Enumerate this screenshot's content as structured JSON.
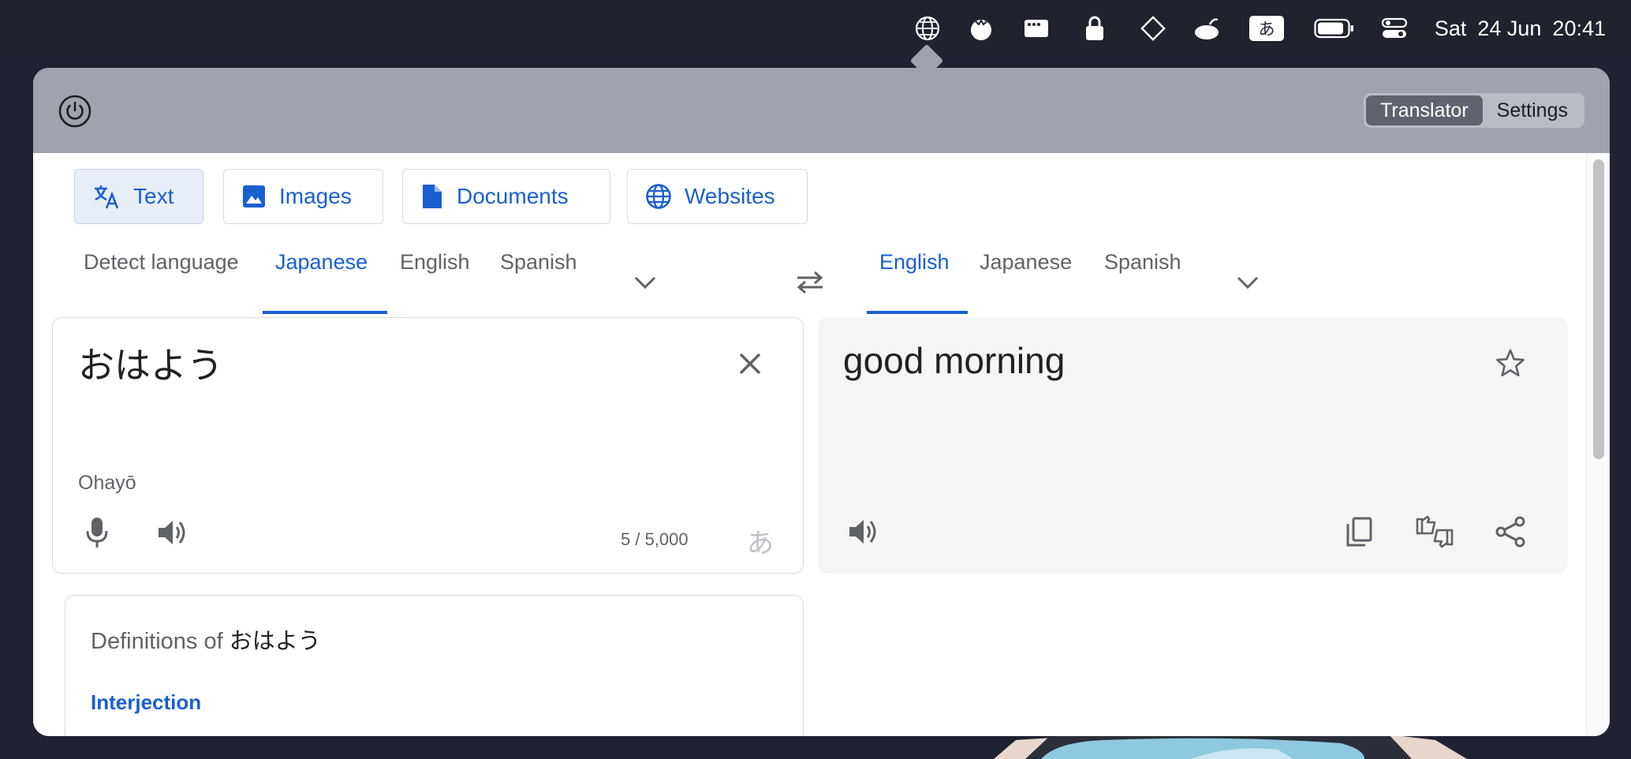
{
  "menubar": {
    "icons": [
      "globe-icon",
      "tomato-icon",
      "window-icon",
      "lock-icon",
      "diamond-icon",
      "cloud-icon",
      "input-method-icon",
      "battery-icon",
      "control-center-icon"
    ],
    "input_method_glyph": "あ",
    "day": "Sat",
    "date": "24 Jun",
    "time": "20:41"
  },
  "header": {
    "tabs": [
      {
        "label": "Translator",
        "active": true
      },
      {
        "label": "Settings",
        "active": false
      }
    ]
  },
  "modes": [
    {
      "label": "Text",
      "icon": "translate-icon",
      "active": true
    },
    {
      "label": "Images",
      "icon": "image-icon",
      "active": false
    },
    {
      "label": "Documents",
      "icon": "document-icon",
      "active": false
    },
    {
      "label": "Websites",
      "icon": "globe-icon",
      "active": false
    }
  ],
  "source_langs": [
    {
      "label": "Detect language",
      "active": false
    },
    {
      "label": "Japanese",
      "active": true
    },
    {
      "label": "English",
      "active": false
    },
    {
      "label": "Spanish",
      "active": false
    }
  ],
  "target_langs": [
    {
      "label": "English",
      "active": true
    },
    {
      "label": "Japanese",
      "active": false
    },
    {
      "label": "Spanish",
      "active": false
    }
  ],
  "source": {
    "text": "おはよう",
    "romanization": "Ohayō",
    "char_count": "5 / 5,000",
    "ime_glyph": "あ"
  },
  "target": {
    "text": "good morning"
  },
  "definitions": {
    "title_prefix": "Definitions of",
    "word": "おはよう",
    "part_of_speech": "Interjection"
  },
  "colors": {
    "accent": "#1a5fd1",
    "header_bg": "#9ea3ae",
    "menubar_bg": "#20232e"
  }
}
